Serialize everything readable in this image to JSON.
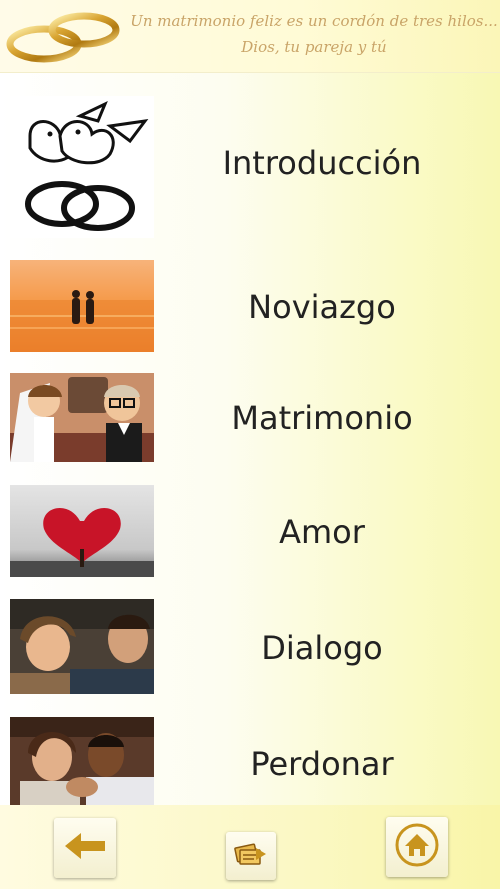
{
  "header": {
    "logo_icon": "wedding-rings-icon",
    "motto_line1": "Un matrimonio feliz es un cordón de tres hilos...",
    "motto_line2": "Dios, tu pareja y tú",
    "motto_color": "#c9a468"
  },
  "menu": {
    "items": [
      {
        "label": "Introducción",
        "image": "doves-and-rings-drawing"
      },
      {
        "label": "Noviazgo",
        "image": "couple-at-sunset-sea"
      },
      {
        "label": "Matrimonio",
        "image": "cartoon-bride-and-groom"
      },
      {
        "label": "Amor",
        "image": "red-heart-tree"
      },
      {
        "label": "Dialogo",
        "image": "couple-lying-together"
      },
      {
        "label": "Perdonar",
        "image": "couple-praying"
      }
    ]
  },
  "footer": {
    "back_icon": "arrow-left-icon",
    "share_icon": "cards-share-icon",
    "home_icon": "home-icon",
    "accent_color": "#c8941e"
  }
}
